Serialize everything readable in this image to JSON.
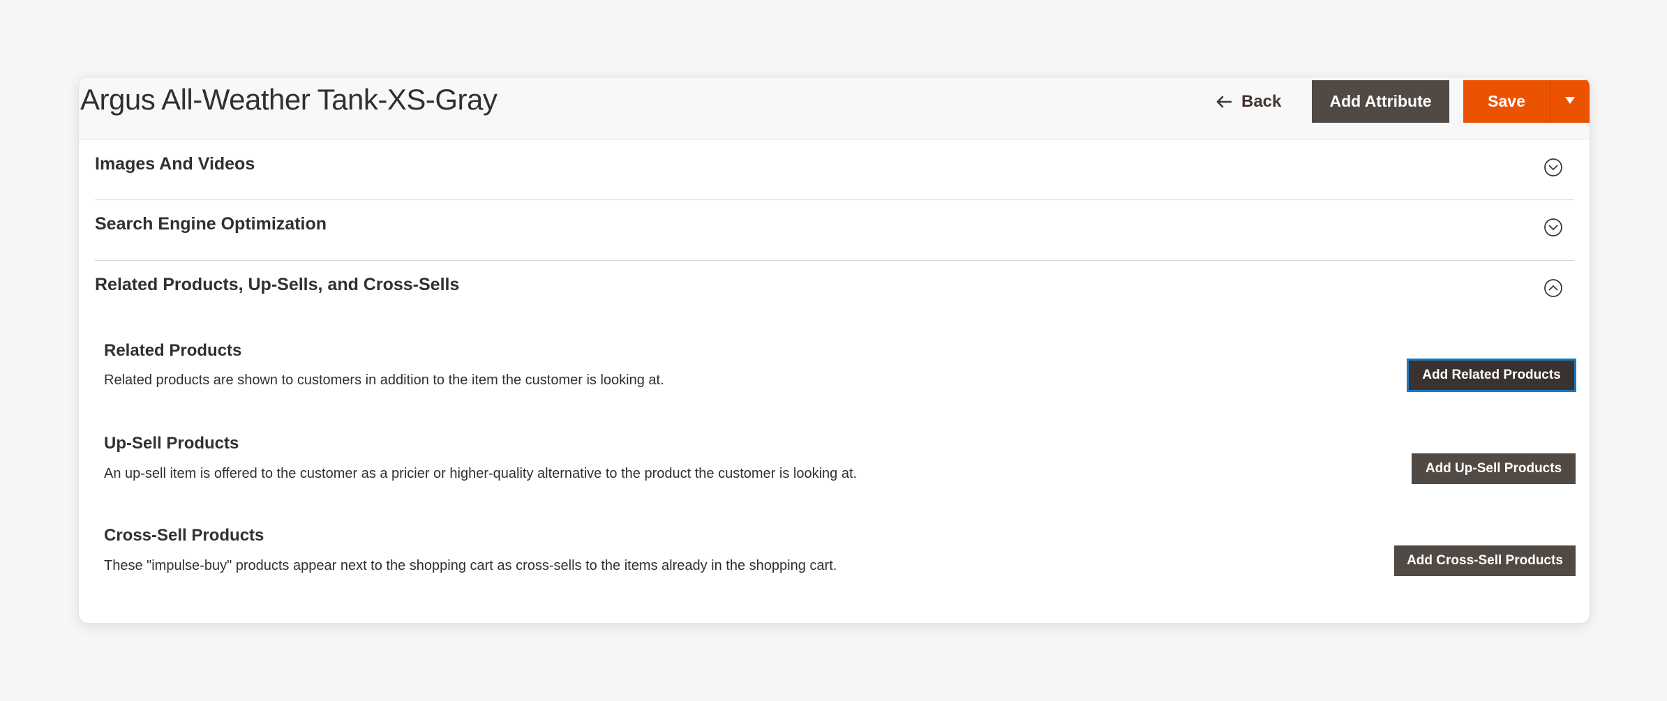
{
  "header": {
    "title": "Argus All-Weather Tank-XS-Gray",
    "back_label": "Back",
    "add_attribute_label": "Add Attribute",
    "save_label": "Save"
  },
  "sections": [
    {
      "title": "Images And Videos",
      "state": "collapsed"
    },
    {
      "title": "Search Engine Optimization",
      "state": "collapsed"
    },
    {
      "title": "Related Products, Up-Sells, and Cross-Sells",
      "state": "expanded"
    }
  ],
  "related": {
    "blocks": [
      {
        "title": "Related Products",
        "description": "Related products are shown to customers in addition to the item the customer is looking at.",
        "button_label": "Add Related Products"
      },
      {
        "title": "Up-Sell Products",
        "description": "An up-sell item is offered to the customer as a pricier or higher-quality alternative to the product the customer is looking at.",
        "button_label": "Add Up-Sell Products"
      },
      {
        "title": "Cross-Sell Products",
        "description": "These \"impulse-buy\" products appear next to the shopping cart as cross-sells to the items already in the shopping cart.",
        "button_label": "Add Cross-Sell Products"
      }
    ]
  },
  "colors": {
    "accent": "#eb5202",
    "button_dark": "#514943",
    "focus_ring": "#1979c3",
    "background": "#f6f6f6"
  },
  "icons": {
    "back": "arrow-left-icon",
    "save_toggle": "caret-down-icon",
    "section_collapsed": "chevron-down-circle-icon",
    "section_expanded": "chevron-up-circle-icon"
  }
}
